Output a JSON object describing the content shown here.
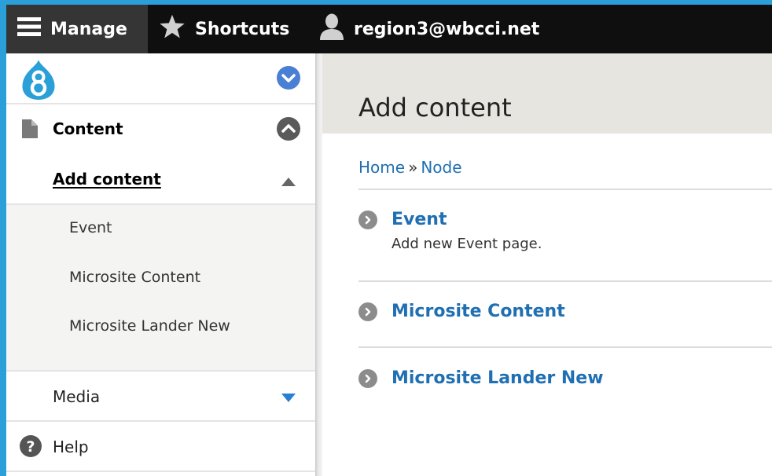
{
  "toolbar": {
    "manage_label": "Manage",
    "shortcuts_label": "Shortcuts",
    "user_label": "region3@wbcci.net"
  },
  "sidebar": {
    "content_label": "Content",
    "add_content_label": "Add content",
    "sub_items": [
      {
        "label": "Event"
      },
      {
        "label": "Microsite Content"
      },
      {
        "label": "Microsite Lander New"
      }
    ],
    "media_label": "Media",
    "help_label": "Help"
  },
  "page": {
    "title": "Add content",
    "breadcrumb": {
      "home": "Home",
      "separator": "»",
      "node": "Node"
    }
  },
  "content_types": [
    {
      "title": "Event",
      "description": "Add new Event page."
    },
    {
      "title": "Microsite Content"
    },
    {
      "title": "Microsite Lander New"
    }
  ],
  "colors": {
    "toolbar_bg": "#0f0f0f",
    "manage_active_bg": "#353535",
    "link_blue": "#1f6fb2",
    "header_bg": "#e6e5e0",
    "drupal_blue": "#2a9fd8"
  }
}
